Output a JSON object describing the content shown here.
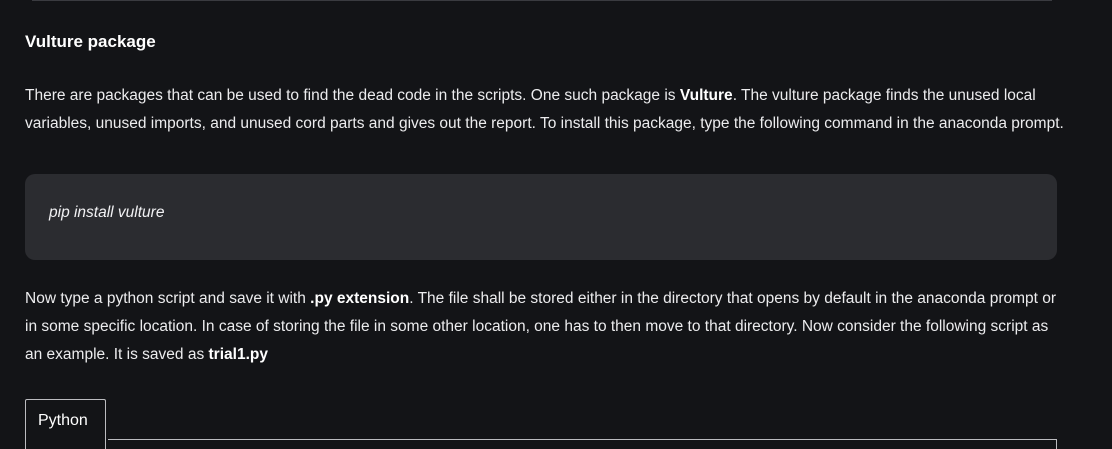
{
  "section": {
    "heading": "Vulture package"
  },
  "para1": {
    "text_a": "There are packages that can be used to find the dead code in the scripts. One such package is ",
    "bold_a": "Vulture",
    "text_b": ". The vulture package finds the unused local variables, unused imports, and unused cord parts and gives out the report. To install this package, type the following command in the anaconda prompt."
  },
  "code_block": {
    "command": "pip install vulture"
  },
  "para2": {
    "text_a": "Now type a python script and save it with ",
    "bold_a": ".py extension",
    "text_b": ". The file shall be stored either in the directory that opens by default in the anaconda prompt or in some specific location. In case of storing the file in some other location, one has to then move to that directory.  Now consider the following script as an example. It is saved as ",
    "bold_b": "trial1.py"
  },
  "code_tabs": {
    "active_tab": "Python"
  }
}
